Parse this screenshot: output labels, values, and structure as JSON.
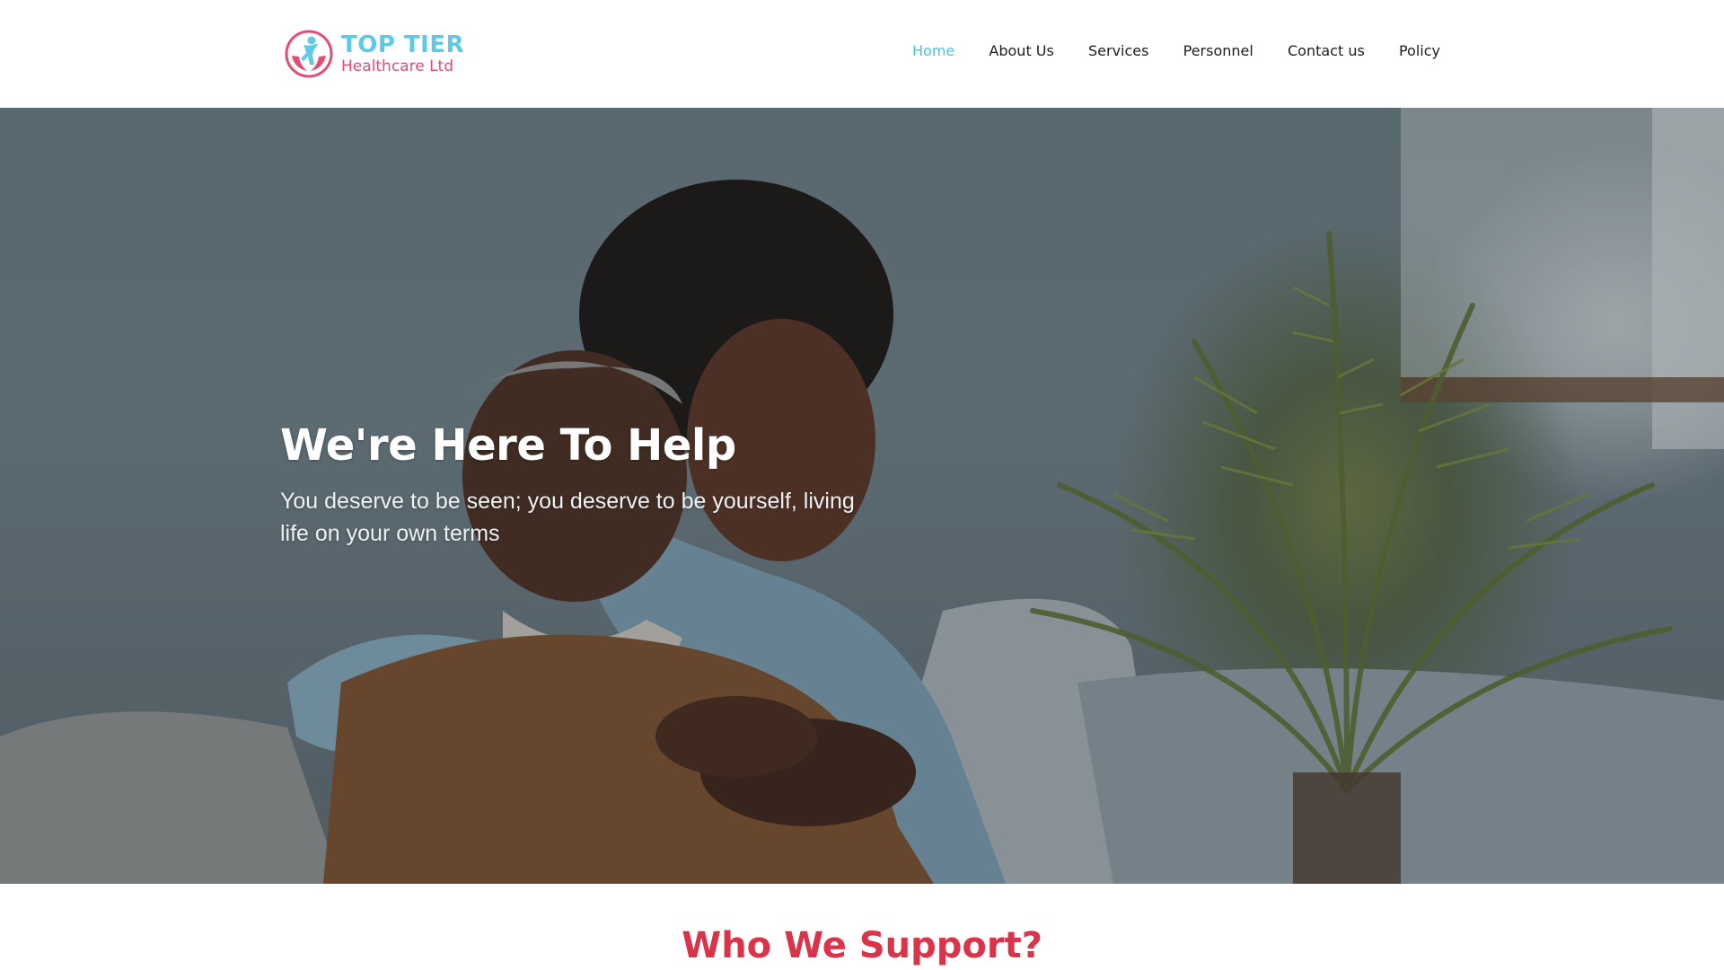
{
  "brand": {
    "name": "TOP TIER",
    "tagline": "Healthcare Ltd",
    "colors": {
      "primary": "#5fc9e6",
      "secondary": "#e44d73"
    },
    "logo_icon": "caring-hands-person-icon"
  },
  "nav": {
    "items": [
      {
        "label": "Home",
        "active": true
      },
      {
        "label": "About Us",
        "active": false
      },
      {
        "label": "Services",
        "active": false
      },
      {
        "label": "Personnel",
        "active": false
      },
      {
        "label": "Contact us",
        "active": false
      },
      {
        "label": "Policy",
        "active": false
      }
    ],
    "active_color": "#3ec8e8"
  },
  "hero": {
    "title": "We're Here To Help",
    "subtitle": "You deserve to be seen; you deserve to be yourself, living life on your own terms",
    "image": "hero-photo-caregiver-hugging-elderly-man"
  },
  "sections": {
    "support_heading": "Who We Support?",
    "heading_color": "#d9344a"
  }
}
